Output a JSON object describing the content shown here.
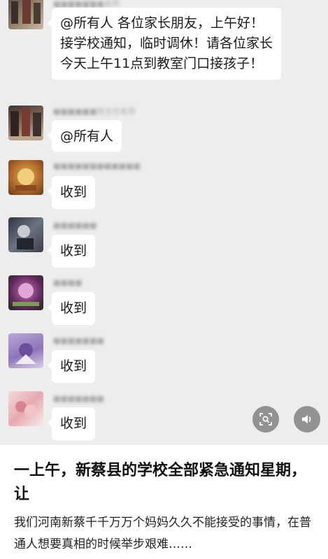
{
  "chat": {
    "messages": [
      {
        "sender": "■■■■■■■老师",
        "text": "@所有人  各位家长朋友，上午好！接学校通知，临时调休！请各位家长今天上午11点到教室门口接孩子！"
      },
      {
        "sender": "■■■■■■班主任老师",
        "text": "@所有人"
      },
      {
        "sender": "■■■■■■■■■■■■",
        "text": "收到"
      },
      {
        "sender": "■■■■■■",
        "text": "收到"
      },
      {
        "sender": "■■■■",
        "text": "收到"
      },
      {
        "sender": "■■■■■■■",
        "text": "收到"
      },
      {
        "sender": "■■■■■■■",
        "text": "收到"
      }
    ]
  },
  "overlay": {
    "left_icon": "scan-icon",
    "right_icon": "speaker-icon"
  },
  "article": {
    "title": "一上午，新蔡县的学校全部紧急通知星期，让",
    "summary": "我们河南新蔡千千万万个妈妈久久不能接受的事情，在普通人想要真相的时候举步艰难……"
  },
  "colors": {
    "chat_background": "#ededed",
    "bubble": "#ffffff",
    "overlay_button": "#787878"
  }
}
